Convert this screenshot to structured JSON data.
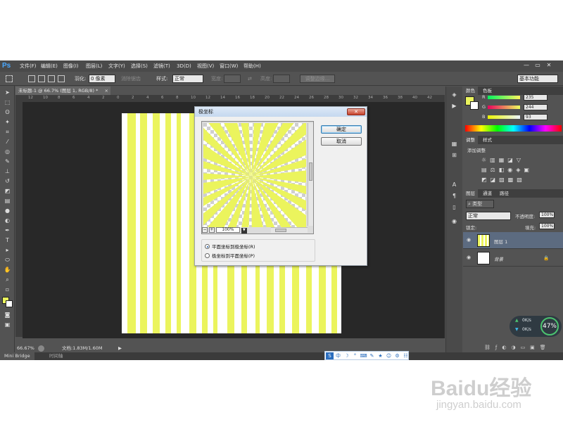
{
  "menubar": {
    "logo": "Ps",
    "items": [
      "文件(F)",
      "编辑(E)",
      "图像(I)",
      "图层(L)",
      "文字(Y)",
      "选择(S)",
      "滤镜(T)",
      "3D(D)",
      "视图(V)",
      "窗口(W)",
      "帮助(H)"
    ],
    "window_controls": [
      "—",
      "▭",
      "✕"
    ]
  },
  "options": {
    "feather_label": "羽化:",
    "feather_value": "0 像素",
    "antialias_label": "消除锯齿",
    "style_label": "样式:",
    "style_value": "正常",
    "width_label": "宽度:",
    "height_label": "高度:",
    "refine_edge": "调整边缘...",
    "workspace": "基本功能"
  },
  "document": {
    "tab_title": "未标题-1 @ 66.7% (图层 1, RGB/8) *",
    "close": "×",
    "ruler_ticks": [
      "12",
      "10",
      "8",
      "6",
      "4",
      "2",
      "0",
      "2",
      "4",
      "6",
      "8",
      "10",
      "12",
      "14",
      "16",
      "18",
      "20",
      "22",
      "24",
      "26",
      "28",
      "30",
      "32",
      "34",
      "36",
      "38",
      "40",
      "42"
    ]
  },
  "statusbar": {
    "zoom": "66.67%",
    "doc_info": "文档:1.83M/1.60M"
  },
  "bottom_tabs": [
    "Mini Bridge",
    "时间轴"
  ],
  "color_panel": {
    "tabs": [
      "颜色",
      "色板"
    ],
    "r_label": "R",
    "g_label": "G",
    "b_label": "B",
    "r": "235",
    "g": "244",
    "b": "93",
    "foreground": "#ebf45d",
    "background": "#ffffff"
  },
  "adjustments_panel": {
    "tabs": [
      "调整",
      "样式"
    ],
    "heading": "添加调整"
  },
  "layers_panel": {
    "tabs": [
      "图层",
      "通道",
      "路径"
    ],
    "filter_label": "类型",
    "blend_mode": "正常",
    "opacity_label": "不透明度:",
    "opacity_value": "100%",
    "lock_label": "锁定:",
    "fill_label": "填充:",
    "fill_value": "100%",
    "layers": [
      {
        "name": "图层 1",
        "selected": true
      },
      {
        "name": "背景",
        "selected": false
      }
    ]
  },
  "dialog": {
    "title": "极坐标",
    "close": "✕",
    "ok": "确定",
    "cancel": "取消",
    "zoom_value": "100%",
    "zoom_minus": "−",
    "zoom_plus": "+",
    "option_rect_to_polar": "平面坐标到极坐标(R)",
    "option_polar_to_rect": "极坐标到平面坐标(P)",
    "selected_option": "rect_to_polar"
  },
  "ime": {
    "items": [
      "S",
      "中",
      "☽",
      "°",
      "⌨",
      "✎",
      "★",
      "☺",
      "⚙",
      "☷"
    ]
  },
  "net_widget": {
    "up": "0K/s",
    "down": "0K/s",
    "percent": "47%"
  },
  "watermark": {
    "brand": "Baidu经验",
    "url": "jingyan.baidu.com"
  },
  "colors": {
    "stripe_yellow": "#ebf45d",
    "app_bg": "#535353",
    "pasteboard": "#282828",
    "selected_layer": "#5c6b80"
  }
}
